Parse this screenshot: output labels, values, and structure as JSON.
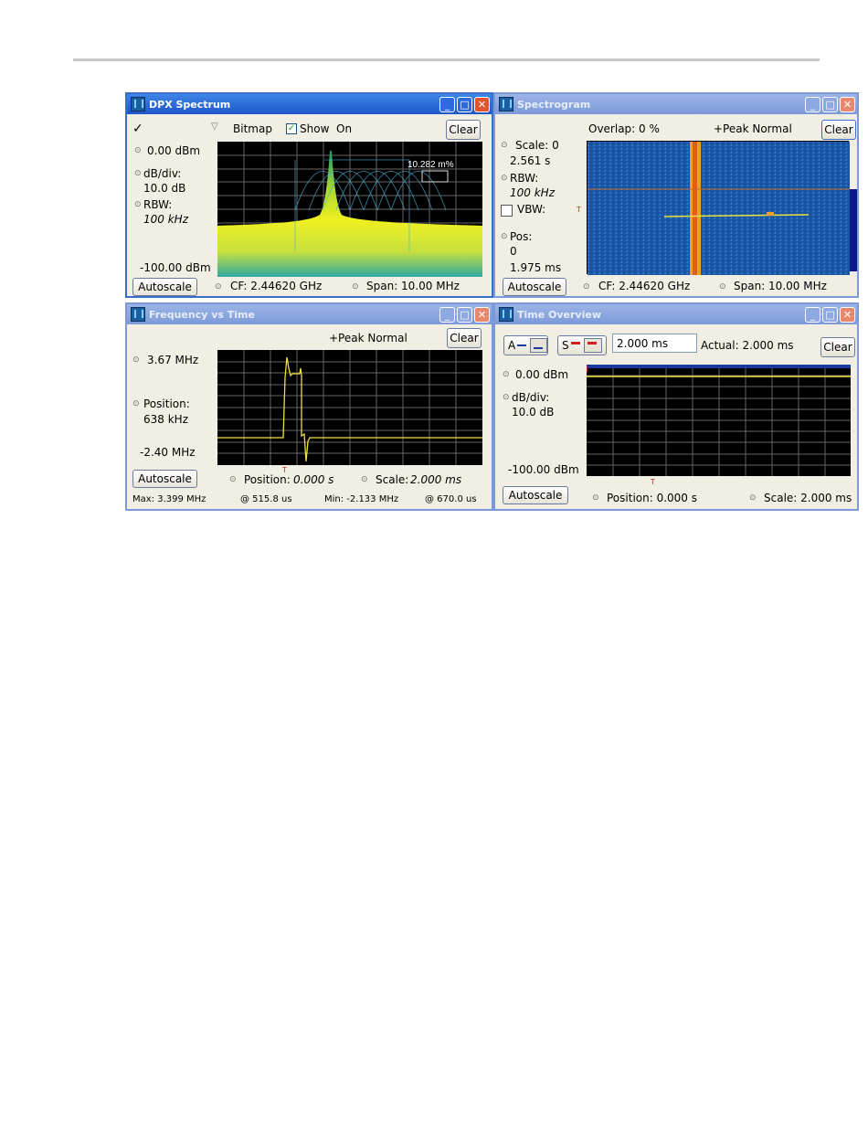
{
  "dpx": {
    "title": "DPX Spectrum",
    "check_mark": "✓",
    "bitmap_label": "Bitmap",
    "show_label": "Show",
    "on_label": "On",
    "clear": "Clear",
    "ref_level": "0.00 dBm",
    "db_div_label": "dB/div:",
    "db_div_value": "10.0 dB",
    "rbw_label": "RBW:",
    "rbw_value": "100 kHz",
    "bottom_level": "-100.00 dBm",
    "autoscale": "Autoscale",
    "cf": "CF: 2.44620 GHz",
    "span": "Span: 10.00 MHz",
    "annotation": "10.282 m%"
  },
  "spectrogram": {
    "title": "Spectrogram",
    "overlap": "Overlap: 0 %",
    "detector": "+Peak Normal",
    "clear": "Clear",
    "scale_label": "Scale: 0",
    "scale_value": "2.561 s",
    "rbw_label": "RBW:",
    "rbw_value": "100 kHz",
    "vbw_label": "VBW:",
    "pos_label": "Pos:",
    "pos_value": "0",
    "pos_time": "1.975 ms",
    "autoscale": "Autoscale",
    "cf": "CF: 2.44620 GHz",
    "span": "Span: 10.00 MHz",
    "trigger_marker": "T"
  },
  "fvt": {
    "title": "Frequency vs Time",
    "detector": "+Peak Normal",
    "clear": "Clear",
    "top": "3.67 MHz",
    "position_label": "Position:",
    "position_value": "638 kHz",
    "bottom": "-2.40 MHz",
    "autoscale": "Autoscale",
    "pos_label": "Position:",
    "pos_value": "0.000 s",
    "scale_label": "Scale:",
    "scale_value": "2.000 ms",
    "max": "Max:  3.399 MHz",
    "max_at": "@  515.8 us",
    "min": "Min: -2.133 MHz",
    "min_at": "@ 670.0 us",
    "trigger_marker": "T"
  },
  "overview": {
    "title": "Time Overview",
    "btn_a": "A",
    "btn_s": "S",
    "time_input": "2.000 ms",
    "actual": "Actual:  2.000 ms",
    "clear": "Clear",
    "ref_level": "0.00 dBm",
    "db_div_label": "dB/div:",
    "db_div_value": "10.0 dB",
    "bottom_level": "-100.00 dBm",
    "autoscale": "Autoscale",
    "position": "Position: 0.000 s",
    "scale": "Scale: 2.000 ms",
    "trigger_marker": "T"
  },
  "icons": {
    "minimize": "minimize-icon",
    "maximize": "maximize-icon",
    "close": "close-icon",
    "knob": "knob-icon",
    "dropdown": "chevron-down-icon"
  },
  "colors": {
    "active_title": "#1d56c7",
    "trace_yellow": "#f0e040",
    "trace_blue": "#1a3aa0",
    "spectrogram_bg": "#1b56a8",
    "spectrogram_hot": "#f0a020"
  }
}
